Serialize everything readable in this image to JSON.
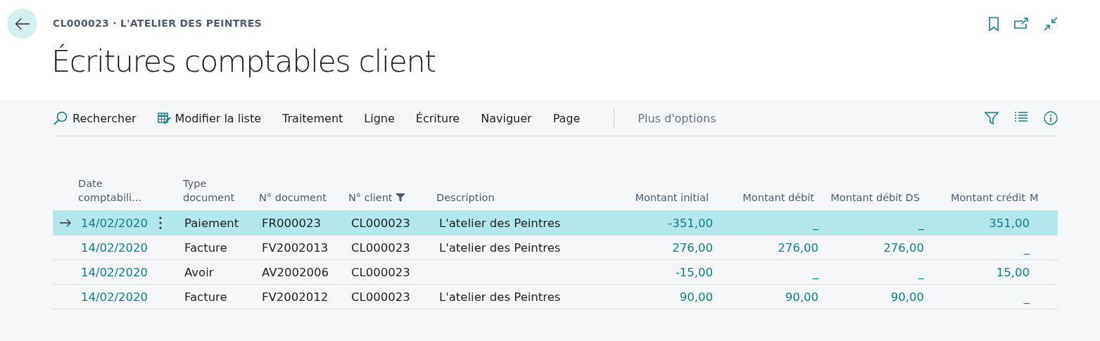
{
  "breadcrumb": "CL000023 · L'ATELIER DES PEINTRES",
  "title": "Écritures comptables client",
  "actions": [
    {
      "label": "Rechercher",
      "kind": "search"
    },
    {
      "label": "Modifier la liste",
      "kind": "edit-list"
    },
    {
      "label": "Traitement"
    },
    {
      "label": "Ligne"
    },
    {
      "label": "Écriture"
    },
    {
      "label": "Naviguer"
    },
    {
      "label": "Page"
    }
  ],
  "more_options": "Plus d'options",
  "table": {
    "columns": [
      {
        "label": "Date comptabili...",
        "filtered": false
      },
      {
        "label": "Type document",
        "filtered": false
      },
      {
        "label": "N° document",
        "filtered": false
      },
      {
        "label": "N° client",
        "filtered": true
      },
      {
        "label": "Description",
        "filtered": false
      },
      {
        "label": "Montant initial",
        "filtered": false
      },
      {
        "label": "Montant débit",
        "filtered": false
      },
      {
        "label": "Montant débit DS",
        "filtered": false
      },
      {
        "label": "Montant crédit",
        "filtered": false
      },
      {
        "label": "M",
        "filtered": false
      }
    ],
    "rows": [
      {
        "selected": true,
        "cells": [
          "14/02/2020",
          "Paiement",
          "FR000023",
          "CL000023",
          "L'atelier des Peintres",
          "-351,00",
          "_",
          "_",
          "351,00"
        ]
      },
      {
        "selected": false,
        "cells": [
          "14/02/2020",
          "Facture",
          "FV2002013",
          "CL000023",
          "L'atelier des Peintres",
          "276,00",
          "276,00",
          "276,00",
          "_"
        ]
      },
      {
        "selected": false,
        "cells": [
          "14/02/2020",
          "Avoir",
          "AV2002006",
          "CL000023",
          "",
          "-15,00",
          "_",
          "_",
          "15,00"
        ]
      },
      {
        "selected": false,
        "cells": [
          "14/02/2020",
          "Facture",
          "FV2002012",
          "CL000023",
          "L'atelier des Peintres",
          "90,00",
          "90,00",
          "90,00",
          "_"
        ]
      }
    ]
  }
}
